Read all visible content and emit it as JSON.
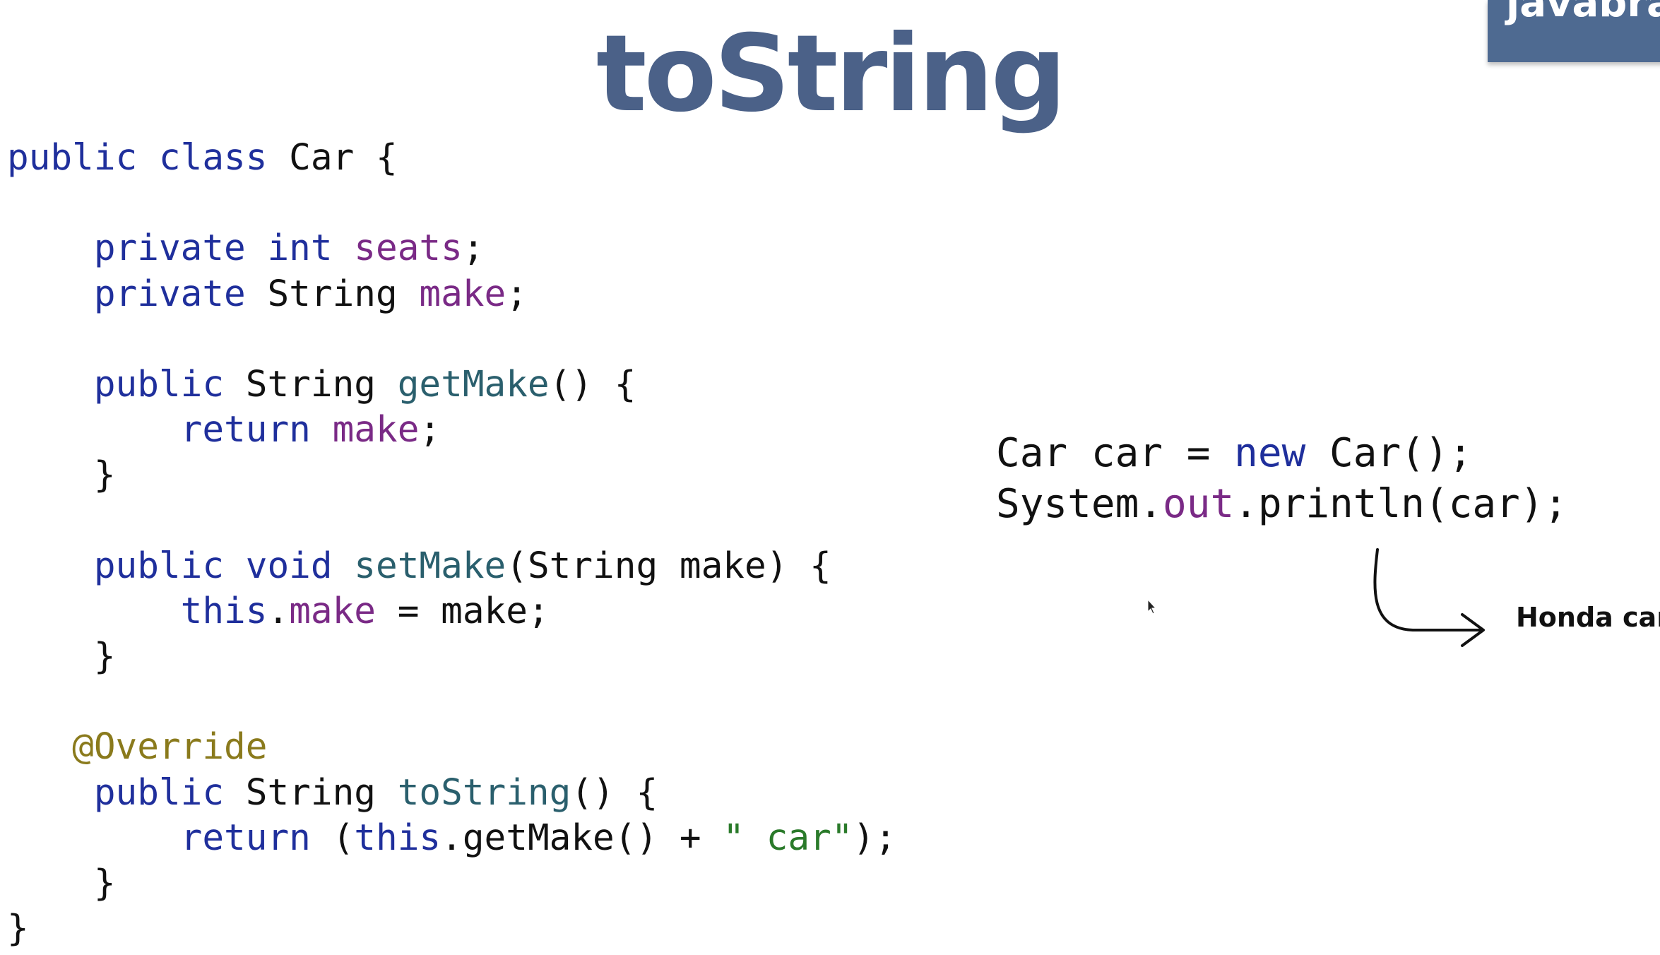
{
  "title": "toString",
  "logo": {
    "text": "javabra",
    "bg_color": "#4e6a91"
  },
  "code": {
    "lines": [
      [
        {
          "t": "public class ",
          "c": "kw"
        },
        {
          "t": "Car {",
          "c": ""
        }
      ],
      [],
      [
        {
          "t": "    ",
          "c": ""
        },
        {
          "t": "private int ",
          "c": "kw"
        },
        {
          "t": "seats",
          "c": "fld"
        },
        {
          "t": ";",
          "c": ""
        }
      ],
      [
        {
          "t": "    ",
          "c": ""
        },
        {
          "t": "private ",
          "c": "kw"
        },
        {
          "t": "String ",
          "c": ""
        },
        {
          "t": "make",
          "c": "fld"
        },
        {
          "t": ";",
          "c": ""
        }
      ],
      [],
      [
        {
          "t": "    ",
          "c": ""
        },
        {
          "t": "public ",
          "c": "kw"
        },
        {
          "t": "String ",
          "c": ""
        },
        {
          "t": "getMake",
          "c": "mth"
        },
        {
          "t": "() {",
          "c": ""
        }
      ],
      [
        {
          "t": "        ",
          "c": ""
        },
        {
          "t": "return ",
          "c": "kw"
        },
        {
          "t": "make",
          "c": "fld"
        },
        {
          "t": ";",
          "c": ""
        }
      ],
      [
        {
          "t": "    }",
          "c": ""
        }
      ],
      [],
      [
        {
          "t": "    ",
          "c": ""
        },
        {
          "t": "public void ",
          "c": "kw"
        },
        {
          "t": "setMake",
          "c": "mth"
        },
        {
          "t": "(String make) {",
          "c": ""
        }
      ],
      [
        {
          "t": "        ",
          "c": ""
        },
        {
          "t": "this",
          "c": "kw"
        },
        {
          "t": ".",
          "c": ""
        },
        {
          "t": "make",
          "c": "fld"
        },
        {
          "t": " = make;",
          "c": ""
        }
      ],
      [
        {
          "t": "    }",
          "c": ""
        }
      ],
      [],
      [
        {
          "t": "   ",
          "c": ""
        },
        {
          "t": "@Override",
          "c": "ann"
        }
      ],
      [
        {
          "t": "    ",
          "c": ""
        },
        {
          "t": "public ",
          "c": "kw"
        },
        {
          "t": "String ",
          "c": ""
        },
        {
          "t": "toString",
          "c": "mth"
        },
        {
          "t": "() {",
          "c": ""
        }
      ],
      [
        {
          "t": "        ",
          "c": ""
        },
        {
          "t": "return ",
          "c": "kw"
        },
        {
          "t": "(",
          "c": ""
        },
        {
          "t": "this",
          "c": "kw"
        },
        {
          "t": ".getMake() + ",
          "c": ""
        },
        {
          "t": "\" car\"",
          "c": "str"
        },
        {
          "t": ");",
          "c": ""
        }
      ],
      [
        {
          "t": "    }",
          "c": ""
        }
      ],
      [
        {
          "t": "}",
          "c": ""
        }
      ]
    ]
  },
  "usage": {
    "lines": [
      [
        {
          "t": "Car car = ",
          "c": ""
        },
        {
          "t": "new ",
          "c": "kw"
        },
        {
          "t": "Car();",
          "c": ""
        }
      ],
      [
        {
          "t": "System.",
          "c": ""
        },
        {
          "t": "out",
          "c": "fld"
        },
        {
          "t": ".println(car);",
          "c": ""
        }
      ]
    ]
  },
  "output_label": "Honda car",
  "colors": {
    "title": "#4b6188",
    "keyword": "#1f2f9c",
    "field": "#7a2a86",
    "method": "#2a5f6d",
    "annotation": "#8a7a1c",
    "string": "#2a7a2a"
  },
  "icons": {
    "arrow": "curved-arrow-icon",
    "cursor": "mouse-pointer-icon"
  }
}
